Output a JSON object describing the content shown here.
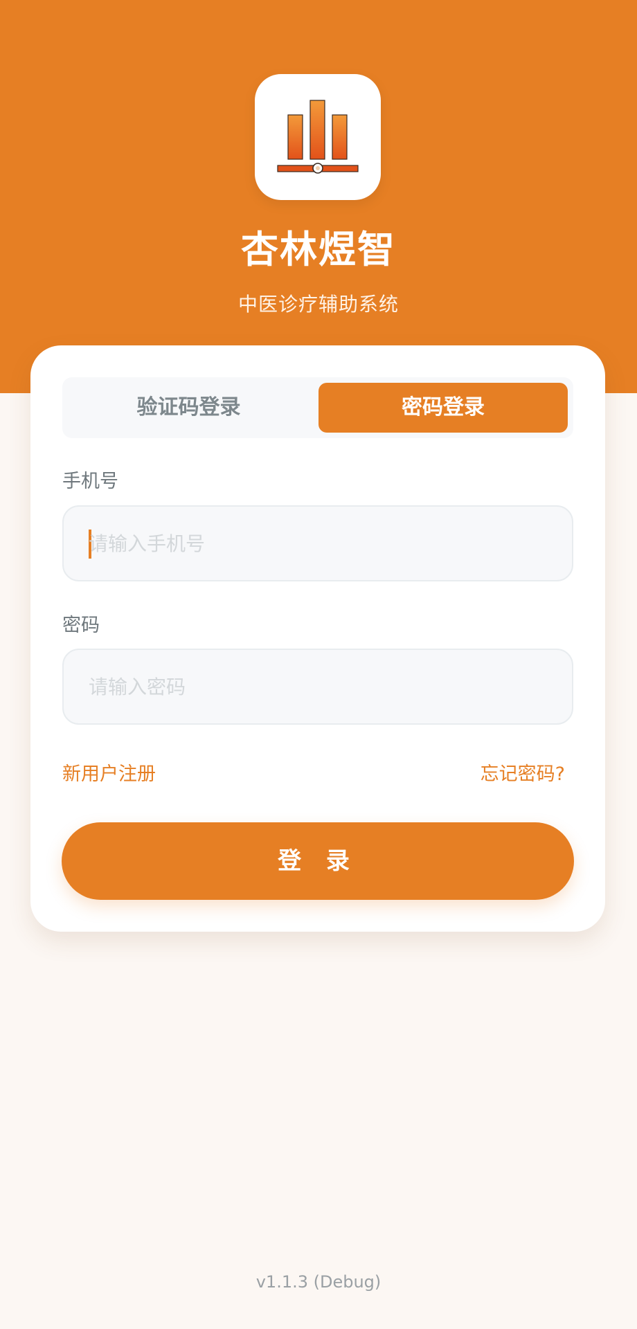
{
  "app": {
    "name": "杏林煜智",
    "subtitle": "中医诊疗辅助系统",
    "logo_icon": "bar-chart-icon",
    "accent_color": "#e67f24"
  },
  "login": {
    "tabs": [
      {
        "label": "验证码登录",
        "active": false
      },
      {
        "label": "密码登录",
        "active": true
      }
    ],
    "phone": {
      "label": "手机号",
      "placeholder": "请输入手机号",
      "value": ""
    },
    "password": {
      "label": "密码",
      "placeholder": "请输入密码",
      "value": ""
    },
    "register_link": "新用户注册",
    "forgot_link": "忘记密码?",
    "submit_label": "登 录"
  },
  "footer": {
    "version": "v1.1.3 (Debug)"
  }
}
